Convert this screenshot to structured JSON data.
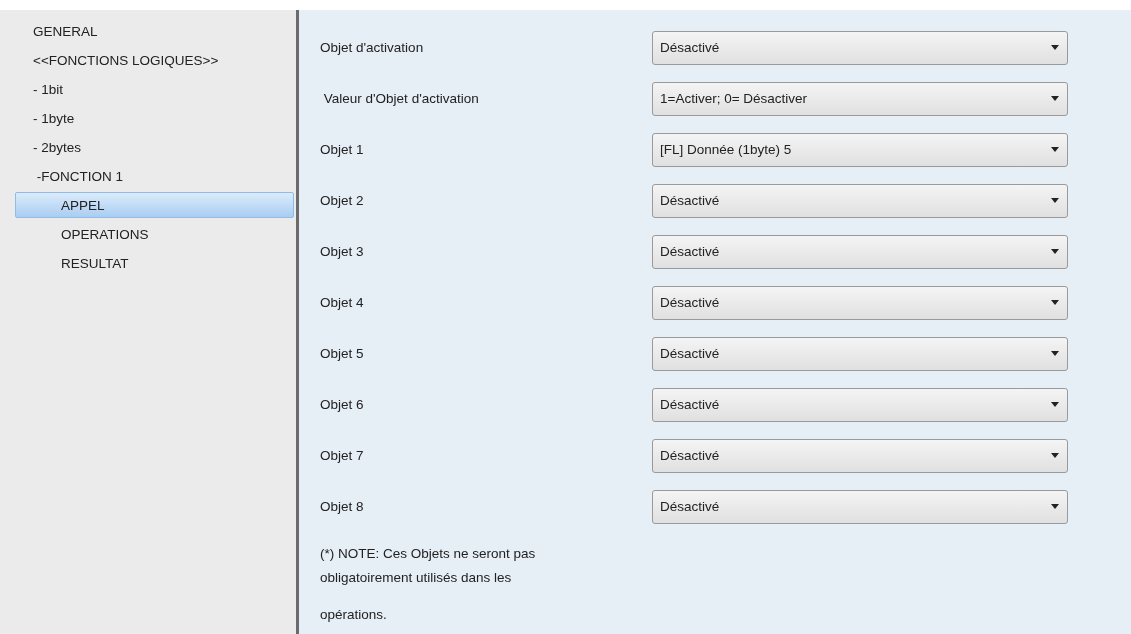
{
  "sidebar": {
    "items": [
      {
        "label": "GENERAL",
        "selected": false
      },
      {
        "label": "<<FONCTIONS LOGIQUES>>",
        "selected": false
      },
      {
        "label": "- 1bit",
        "selected": false
      },
      {
        "label": "- 1byte",
        "selected": false
      },
      {
        "label": "- 2bytes",
        "selected": false
      },
      {
        "label": " -FONCTION 1",
        "selected": false,
        "children": [
          {
            "label": "APPEL",
            "selected": true
          },
          {
            "label": "OPERATIONS",
            "selected": false
          },
          {
            "label": "RESULTAT",
            "selected": false
          }
        ]
      }
    ]
  },
  "parameters": [
    {
      "label": "Objet d'activation",
      "value": "Désactivé"
    },
    {
      "label": " Valeur d'Objet d'activation",
      "value": "1=Activer; 0= Désactiver"
    },
    {
      "label": "Objet 1",
      "value": "[FL] Donnée (1byte) 5"
    },
    {
      "label": "Objet 2",
      "value": "Désactivé"
    },
    {
      "label": "Objet 3",
      "value": "Désactivé"
    },
    {
      "label": "Objet 4",
      "value": "Désactivé"
    },
    {
      "label": "Objet 5",
      "value": "Désactivé"
    },
    {
      "label": "Objet 6",
      "value": "Désactivé"
    },
    {
      "label": "Objet 7",
      "value": "Désactivé"
    },
    {
      "label": "Objet 8",
      "value": "Désactivé"
    }
  ],
  "note": {
    "lines": [
      "(*) NOTE: Ces Objets ne seront pas",
      "obligatoirement utilisés dans les",
      "opérations."
    ]
  }
}
